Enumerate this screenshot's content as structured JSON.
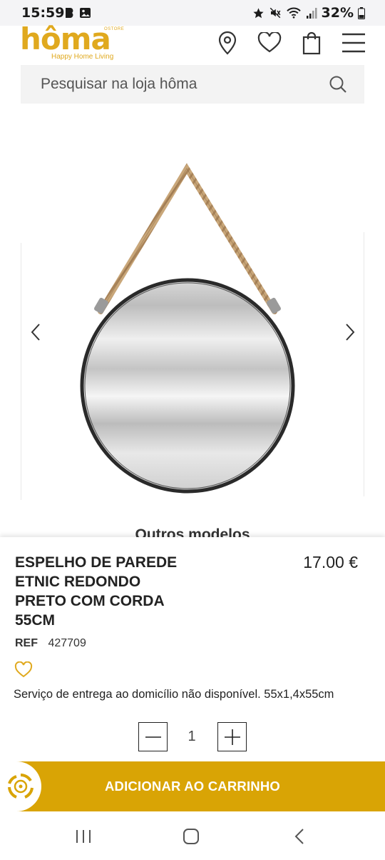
{
  "status_bar": {
    "time": "15:59",
    "battery": "32%",
    "icons": [
      "notification-b-icon",
      "image-icon",
      "star-icon",
      "mute-icon",
      "wifi-icon",
      "signal-icon",
      "battery-icon"
    ]
  },
  "header": {
    "logo_text": "hôma",
    "logo_store": "OSTORE",
    "logo_tagline": "Happy Home Living",
    "icons": [
      "location-pin-icon",
      "heart-icon",
      "shopping-bag-icon",
      "menu-icon"
    ],
    "brand_color": "#e0a91e"
  },
  "search": {
    "placeholder": "Pesquisar na loja hôma"
  },
  "gallery": {
    "image_name": "round-mirror-with-rope",
    "prev_icon": "chevron-left-icon",
    "next_icon": "chevron-right-icon"
  },
  "other_models": {
    "label": "Outros modelos"
  },
  "product": {
    "title": "ESPELHO DE PAREDE ETNIC REDONDO PRETO COM CORDA 55CM",
    "price": "17.00 €",
    "ref_label": "REF",
    "ref_value": "427709",
    "delivery_note": "Serviço de entrega ao domicílio não disponível. 55x1,4x55cm"
  },
  "quantity": {
    "value": "1",
    "minus_icon": "minus-icon",
    "plus_icon": "plus-icon"
  },
  "cart": {
    "add_label": "ADICIONAR AO CARRINHO",
    "accent_color": "#d9a405"
  },
  "nav": {
    "icons": [
      "recent-apps-icon",
      "home-icon",
      "back-icon"
    ]
  }
}
